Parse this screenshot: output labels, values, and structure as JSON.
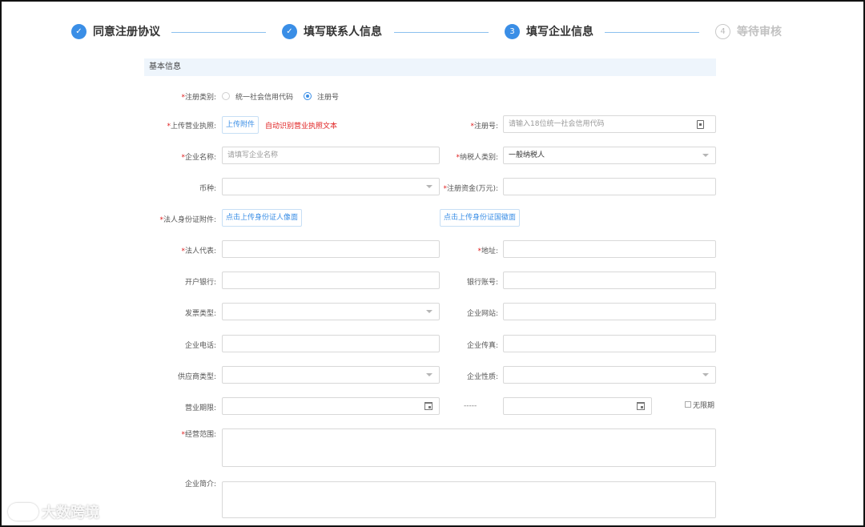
{
  "stepper": {
    "steps": [
      {
        "index": "1",
        "label": "同意注册协议",
        "state": "done",
        "icon": "check-icon"
      },
      {
        "index": "2",
        "label": "填写联系人信息",
        "state": "done",
        "icon": "check-icon"
      },
      {
        "index": "3",
        "label": "填写企业信息",
        "state": "active"
      },
      {
        "index": "4",
        "label": "等待审核",
        "state": "pending"
      }
    ]
  },
  "section": {
    "title": "基本信息"
  },
  "form": {
    "reg_type": {
      "label": "注册类别:",
      "options": [
        "统一社会信用代码",
        "注册号"
      ],
      "selected": "注册号"
    },
    "license": {
      "label": "上传营业执照:",
      "button": "上传附件",
      "hint": "自动识别营业执照文本"
    },
    "reg_no": {
      "label": "注册号:",
      "placeholder": "请输入18位统一社会信用代码"
    },
    "company_name": {
      "label": "企业名称:",
      "placeholder": "请填写企业名称"
    },
    "taxpayer_type": {
      "label": "纳税人类别:",
      "value": "一般纳税人"
    },
    "currency": {
      "label": "币种:",
      "value": ""
    },
    "capital": {
      "label": "注册资金(万元):",
      "value": ""
    },
    "id_attach": {
      "label": "法人身份证附件:",
      "front_button": "点击上传身份证人像面",
      "back_button": "点击上传身份证国徽面"
    },
    "legal_rep": {
      "label": "法人代表:",
      "value": ""
    },
    "address": {
      "label": "地址:",
      "value": ""
    },
    "bank": {
      "label": "开户银行:",
      "value": ""
    },
    "bank_account": {
      "label": "银行账号:",
      "value": ""
    },
    "invoice_type": {
      "label": "发票类型:",
      "value": ""
    },
    "website": {
      "label": "企业网站:",
      "value": ""
    },
    "phone": {
      "label": "企业电话:",
      "value": ""
    },
    "fax": {
      "label": "企业传真:",
      "value": ""
    },
    "supplier_type": {
      "label": "供应商类型:",
      "value": ""
    },
    "nature": {
      "label": "企业性质:",
      "value": ""
    },
    "term": {
      "label": "营业期限:",
      "separator": "-----",
      "no_limit": "无限期"
    },
    "scope": {
      "label": "经营范围:"
    },
    "intro": {
      "label": "企业简介:"
    }
  },
  "watermark": {
    "text": "大数跨境"
  }
}
